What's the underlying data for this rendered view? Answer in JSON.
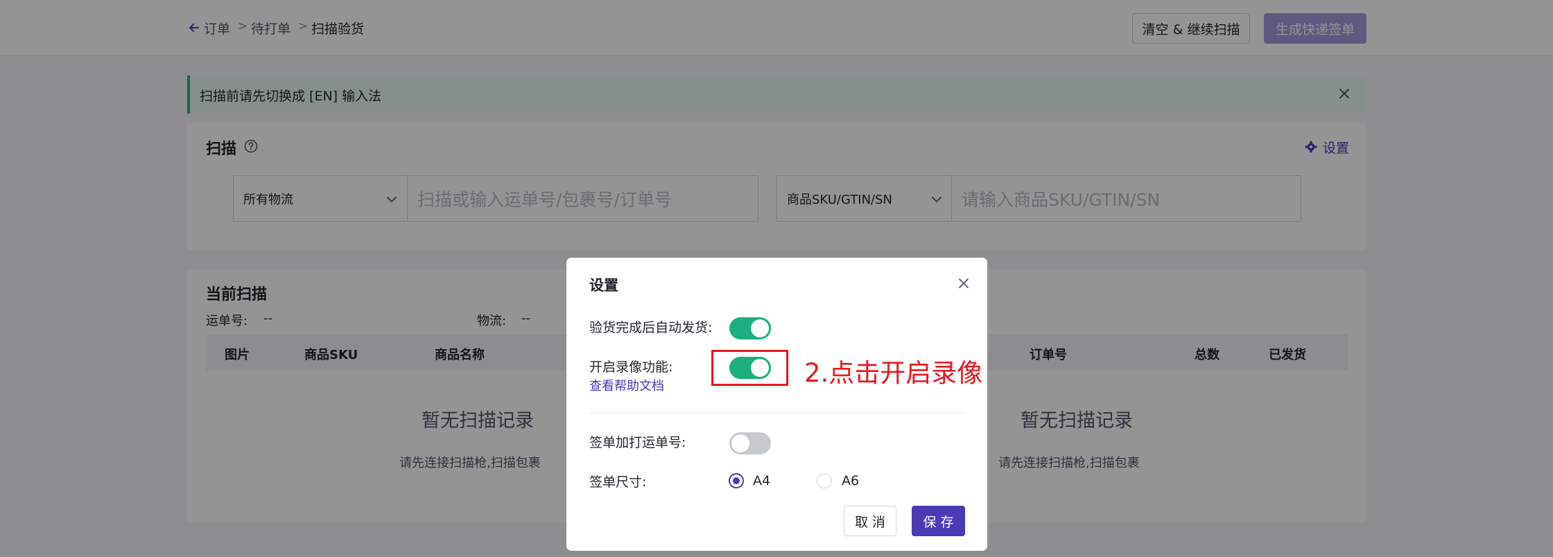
{
  "breadcrumb": {
    "root": "订单",
    "mid": "待打单",
    "current": "扫描验货",
    "sep": ">"
  },
  "header": {
    "clear_button": "清空 & 继续扫描",
    "generate_button": "生成快递签单"
  },
  "alert": {
    "text": "扫描前请先切换成 [EN] 输入法"
  },
  "scan": {
    "title": "扫描",
    "settings_label": "设置",
    "logistics_select": "所有物流",
    "tracking_placeholder": "扫描或输入运单号/包裹号/订单号",
    "sku_select": "商品SKU/GTIN/SN",
    "sku_placeholder": "请输入商品SKU/GTIN/SN"
  },
  "current": {
    "title": "当前扫描",
    "tracking_label": "运单号:",
    "tracking_value": "--",
    "logistics_label": "物流:",
    "logistics_value": "--",
    "columns": [
      "图片",
      "商品SKU",
      "商品名称",
      "订单号",
      "总数",
      "已发货"
    ],
    "empty_title": "暂无扫描记录",
    "empty_sub": "请先连接扫描枪,扫描包裹"
  },
  "modal": {
    "title": "设置",
    "auto_ship_label": "验货完成后自动发货:",
    "auto_ship_on": true,
    "record_label": "开启录像功能:",
    "record_on": true,
    "help_link": "查看帮助文档",
    "print_tracking_label": "签单加打运单号:",
    "print_tracking_on": false,
    "size_label": "签单尺寸:",
    "size_options": [
      "A4",
      "A6"
    ],
    "size_selected": "A4",
    "cancel_button": "取 消",
    "save_button": "保 存"
  },
  "annotation": {
    "text": "2.点击开启录像",
    "color": "#e5191f"
  },
  "colors": {
    "primary": "#4a3ab5",
    "toggle_on": "#1bae7e",
    "alert_accent": "#23b27f"
  }
}
